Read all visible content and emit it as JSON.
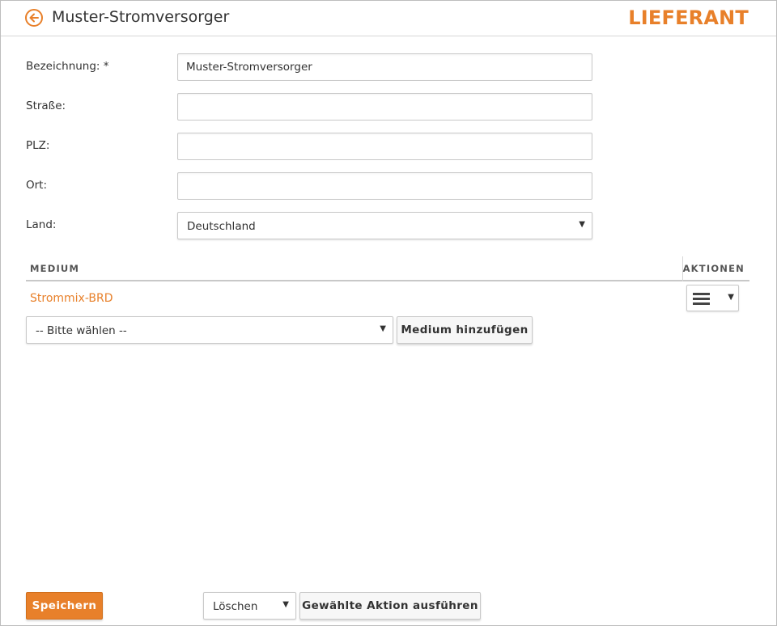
{
  "header": {
    "back_icon": "arrow-left-circle-icon",
    "title": "Muster-Stromversorger",
    "section": "LIEFERANT",
    "accent_color": "#e8802a"
  },
  "form": {
    "bezeichnung": {
      "label": "Bezeichnung: *",
      "value": "Muster-Stromversorger"
    },
    "strasse": {
      "label": "Straße:",
      "value": ""
    },
    "plz": {
      "label": "PLZ:",
      "value": ""
    },
    "ort": {
      "label": "Ort:",
      "value": ""
    },
    "land": {
      "label": "Land:",
      "value": "Deutschland"
    }
  },
  "media_table": {
    "col_medium": "MEDIUM",
    "col_actions": "AKTIONEN",
    "rows": [
      {
        "name": "Strommix-BRD",
        "actions_icon": "hamburger-menu-icon"
      }
    ],
    "add_select_value": "-- Bitte wählen --",
    "add_button": "Medium hinzufügen"
  },
  "footer": {
    "save_button": "Speichern",
    "action_select_value": "Löschen",
    "run_action_button": "Gewählte Aktion ausführen"
  }
}
